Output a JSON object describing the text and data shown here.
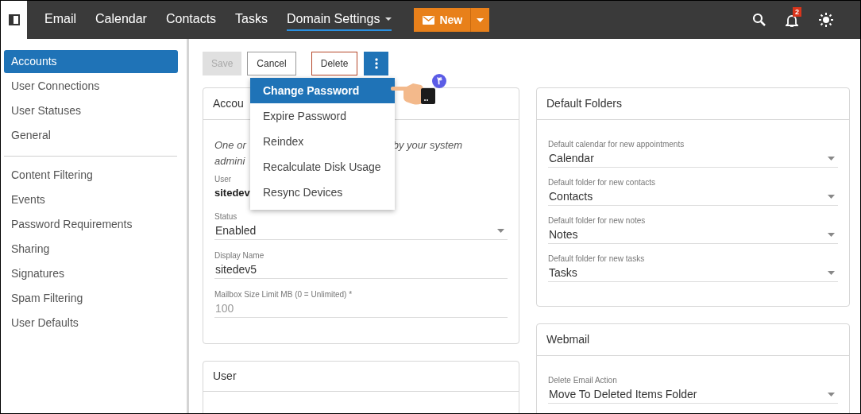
{
  "topbar": {
    "nav": [
      {
        "label": "Email",
        "selected": false,
        "dropdown": false
      },
      {
        "label": "Calendar",
        "selected": false,
        "dropdown": false
      },
      {
        "label": "Contacts",
        "selected": false,
        "dropdown": false
      },
      {
        "label": "Tasks",
        "selected": false,
        "dropdown": false
      },
      {
        "label": "Domain Settings",
        "selected": true,
        "dropdown": true
      }
    ],
    "new_button": "New",
    "notification_count": "2"
  },
  "sidebar": {
    "groups": [
      [
        {
          "label": "Accounts",
          "selected": true
        },
        {
          "label": "User Connections",
          "selected": false
        },
        {
          "label": "User Statuses",
          "selected": false
        },
        {
          "label": "General",
          "selected": false
        }
      ],
      [
        {
          "label": "Content Filtering",
          "selected": false
        },
        {
          "label": "Events",
          "selected": false
        },
        {
          "label": "Password Requirements",
          "selected": false
        },
        {
          "label": "Sharing",
          "selected": false
        },
        {
          "label": "Signatures",
          "selected": false
        },
        {
          "label": "Spam Filtering",
          "selected": false
        },
        {
          "label": "User Defaults",
          "selected": false
        }
      ]
    ]
  },
  "toolbar": [
    {
      "label": "Save",
      "kind": "disabled"
    },
    {
      "label": "Cancel",
      "kind": "plain"
    },
    {
      "label": "Delete",
      "kind": "danger"
    }
  ],
  "menu": {
    "items": [
      {
        "label": "Change Password",
        "selected": true
      },
      {
        "label": "Expire Password",
        "selected": false
      },
      {
        "label": "Reindex",
        "selected": false
      },
      {
        "label": "Recalculate Disk Usage",
        "selected": false
      },
      {
        "label": "Resync Devices",
        "selected": false
      }
    ]
  },
  "annotation": {
    "step": "۴"
  },
  "account_card": {
    "title": "Accou",
    "note_left": "One or",
    "note_right": "by your system",
    "note_line2": "admini",
    "user_label": "User",
    "user_value": "sitedev",
    "fields": [
      {
        "label": "Status",
        "value": "Enabled",
        "kind": "select",
        "disabled": false
      },
      {
        "label": "Display Name",
        "value": "sitedev5",
        "kind": "text",
        "disabled": false
      },
      {
        "label": "Mailbox Size Limit MB (0 = Unlimited) *",
        "value": "100",
        "kind": "text",
        "disabled": true
      }
    ]
  },
  "user_card": {
    "title": "User"
  },
  "default_folders": {
    "title": "Default Folders",
    "fields": [
      {
        "label": "Default calendar for new appointments",
        "value": "Calendar",
        "kind": "select",
        "disabled": false
      },
      {
        "label": "Default folder for new contacts",
        "value": "Contacts",
        "kind": "select",
        "disabled": false
      },
      {
        "label": "Default folder for new notes",
        "value": "Notes",
        "kind": "select",
        "disabled": false
      },
      {
        "label": "Default folder for new tasks",
        "value": "Tasks",
        "kind": "select",
        "disabled": false
      }
    ]
  },
  "webmail": {
    "title": "Webmail",
    "fields": [
      {
        "label": "Delete Email Action",
        "value": "Move To Deleted Items Folder",
        "kind": "select",
        "disabled": false
      }
    ]
  }
}
